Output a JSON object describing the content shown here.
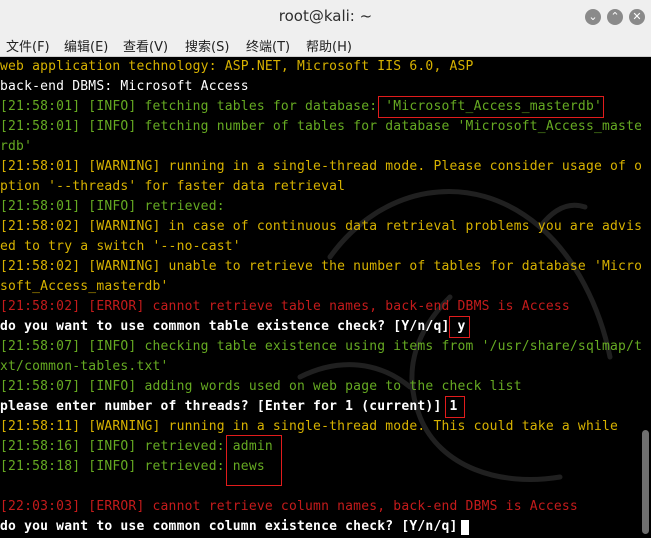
{
  "window": {
    "title": "root@kali: ~",
    "buttons": {
      "minimize": "⌄",
      "maximize": "⌃",
      "close": "✕"
    }
  },
  "menu": [
    {
      "label": "文件(F)"
    },
    {
      "label": "编辑(E)"
    },
    {
      "label": "查看(V)"
    },
    {
      "label": "搜索(S)"
    },
    {
      "label": "终端(T)"
    },
    {
      "label": "帮助(H)"
    }
  ],
  "terminal": {
    "lines": [
      {
        "color": "w",
        "text": "web application technology: ASP.NET, Microsoft IIS 6.0, ASP"
      },
      {
        "color": "w",
        "text": "back-end DBMS: Microsoft Access"
      },
      {
        "color": "g",
        "text": "[21:58:01] [INFO] fetching tables for database: 'Microsoft_Access_masterdb'"
      },
      {
        "color": "g",
        "text": "[21:58:01] [INFO] fetching number of tables for database 'Microsoft_Access_maste"
      },
      {
        "color": "g",
        "text": "rdb'"
      },
      {
        "color": "y",
        "text": "[21:58:01] [WARNING] running in a single-thread mode. Please consider usage of o"
      },
      {
        "color": "y",
        "text": "ption '--threads' for faster data retrieval"
      },
      {
        "color": "g",
        "text": "[21:58:01] [INFO] retrieved:"
      },
      {
        "color": "y",
        "text": "[21:58:02] [WARNING] in case of continuous data retrieval problems you are advis"
      },
      {
        "color": "y",
        "text": "ed to try a switch '--no-cast'"
      },
      {
        "color": "y",
        "text": "[21:58:02] [WARNING] unable to retrieve the number of tables for database 'Micro"
      },
      {
        "color": "y",
        "text": "soft_Access_masterdb'"
      },
      {
        "color": "r",
        "text": "[21:58:02] [ERROR] cannot retrieve table names, back-end DBMS is Access"
      },
      {
        "color": "w",
        "bold": true,
        "text": "do you want to use common table existence check? [Y/n/q] y"
      },
      {
        "color": "g",
        "text": "[21:58:07] [INFO] checking table existence using items from '/usr/share/sqlmap/t"
      },
      {
        "color": "g",
        "text": "xt/common-tables.txt'"
      },
      {
        "color": "g",
        "text": "[21:58:07] [INFO] adding words used on web page to the check list"
      },
      {
        "color": "w",
        "bold": true,
        "text": "please enter number of threads? [Enter for 1 (current)] 1"
      },
      {
        "color": "y",
        "text": "[21:58:11] [WARNING] running in a single-thread mode. This could take a while"
      },
      {
        "color": "g",
        "text": "[21:58:16] [INFO] retrieved: admin"
      },
      {
        "color": "g",
        "text": "[21:58:18] [INFO] retrieved: news"
      },
      {
        "color": "w",
        "text": ""
      },
      {
        "color": "r",
        "text": "[22:03:03] [ERROR] cannot retrieve column names, back-end DBMS is Access"
      },
      {
        "color": "w",
        "bold": true,
        "text": "do you want to use common column existence check? [Y/n/q] "
      }
    ]
  }
}
